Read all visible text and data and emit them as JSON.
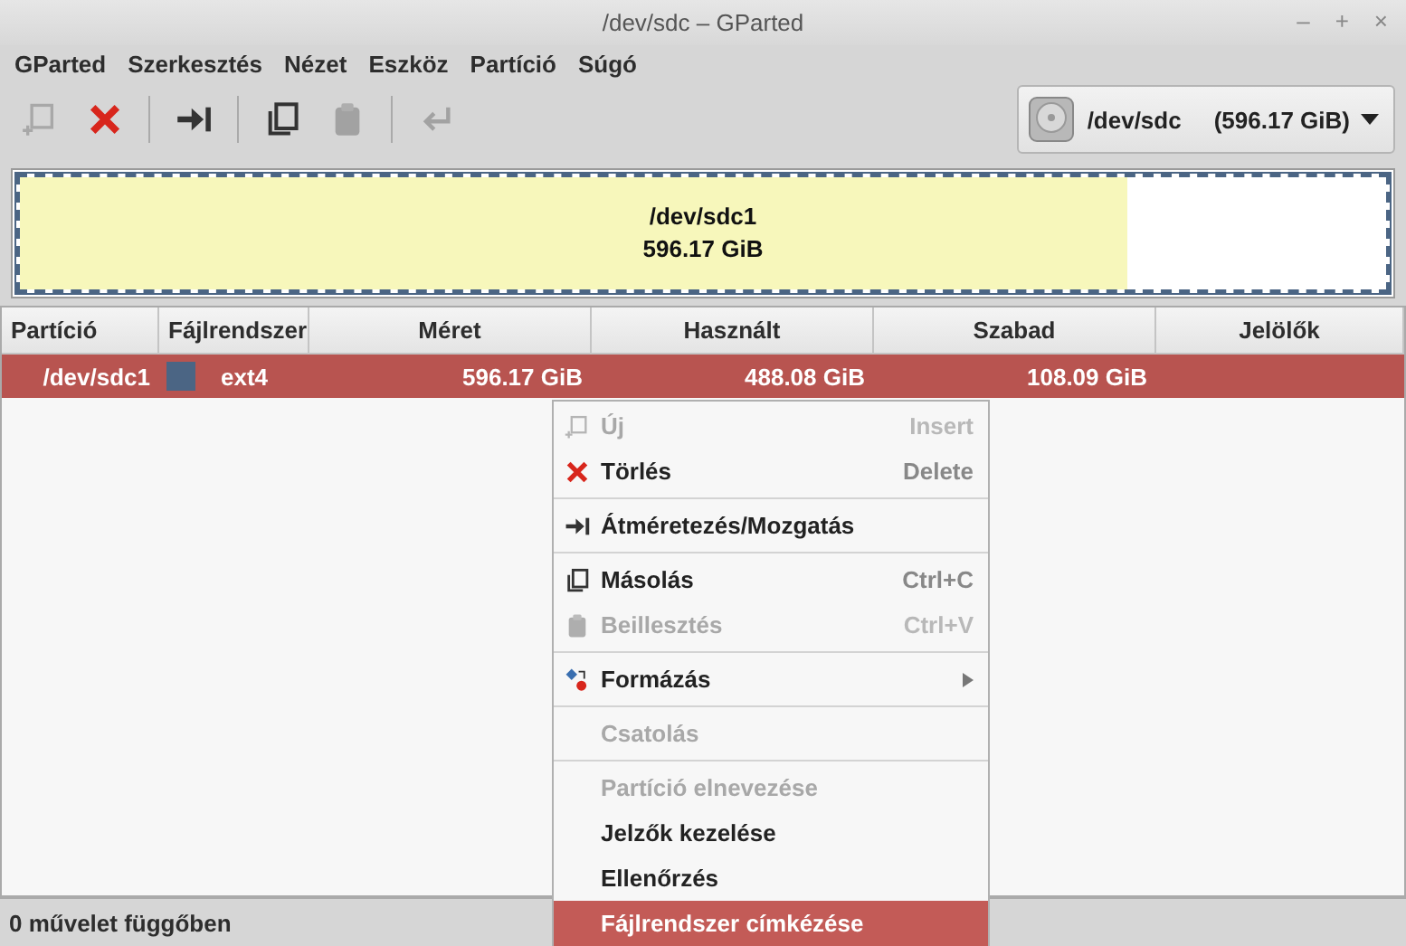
{
  "window": {
    "title": "/dev/sdc – GParted",
    "controls": [
      "–",
      "+",
      "×"
    ]
  },
  "menubar": [
    "GParted",
    "Szerkesztés",
    "Nézet",
    "Eszköz",
    "Partíció",
    "Súgó"
  ],
  "toolbar": [
    {
      "kind": "new",
      "disabled": true
    },
    {
      "kind": "delete",
      "disabled": false
    },
    {
      "kind": "separator"
    },
    {
      "kind": "resize",
      "disabled": false
    },
    {
      "kind": "separator"
    },
    {
      "kind": "copy",
      "disabled": false
    },
    {
      "kind": "paste",
      "disabled": true
    },
    {
      "kind": "separator"
    },
    {
      "kind": "undo",
      "disabled": true
    }
  ],
  "device": {
    "name": "/dev/sdc",
    "size": "(596.17 GiB)"
  },
  "disk_map": {
    "partition": "/dev/sdc1",
    "size": "596.17 GiB",
    "level": 0.81
  },
  "table": {
    "columns": [
      "Partíció",
      "Fájlrendszer",
      "Méret",
      "Használt",
      "Szabad",
      "Jelölők"
    ],
    "rows": [
      {
        "partition": "/dev/sdc1",
        "filesystem": "ext4",
        "color": "#4b6584",
        "size": "596.17 GiB",
        "used": "488.08 GiB",
        "free": "108.09 GiB",
        "selected": true
      }
    ]
  },
  "context_menu": [
    {
      "kind": "new",
      "label": "Új",
      "shortcut": "Insert",
      "disabled": true,
      "selected": false
    },
    {
      "kind": "delete",
      "label": "Törlés",
      "shortcut": "Delete",
      "disabled": false,
      "selected": false
    },
    {
      "kind": "separator"
    },
    {
      "kind": "resize",
      "label": "Átméretezés/Mozgatás",
      "disabled": false,
      "selected": false
    },
    {
      "kind": "separator"
    },
    {
      "kind": "copy",
      "label": "Másolás",
      "shortcut": "Ctrl+C",
      "disabled": false,
      "selected": false
    },
    {
      "kind": "paste",
      "label": "Beillesztés",
      "shortcut": "Ctrl+V",
      "disabled": true,
      "selected": false
    },
    {
      "kind": "separator"
    },
    {
      "kind": "format",
      "label": "Formázás",
      "submenu": true,
      "disabled": false,
      "selected": false
    },
    {
      "kind": "separator"
    },
    {
      "kind": "item",
      "label": "Csatolás",
      "disabled": true,
      "selected": false
    },
    {
      "kind": "separator"
    },
    {
      "kind": "item",
      "label": "Partíció elnevezése",
      "disabled": true,
      "selected": false
    },
    {
      "kind": "item",
      "label": "Jelzők kezelése",
      "disabled": false,
      "selected": false
    },
    {
      "kind": "item",
      "label": "Ellenőrzés",
      "disabled": false,
      "selected": false
    },
    {
      "kind": "item",
      "label": "Fájlrendszer címkézése",
      "disabled": false,
      "selected": true
    }
  ],
  "status_bar": "0 művelet függőben"
}
